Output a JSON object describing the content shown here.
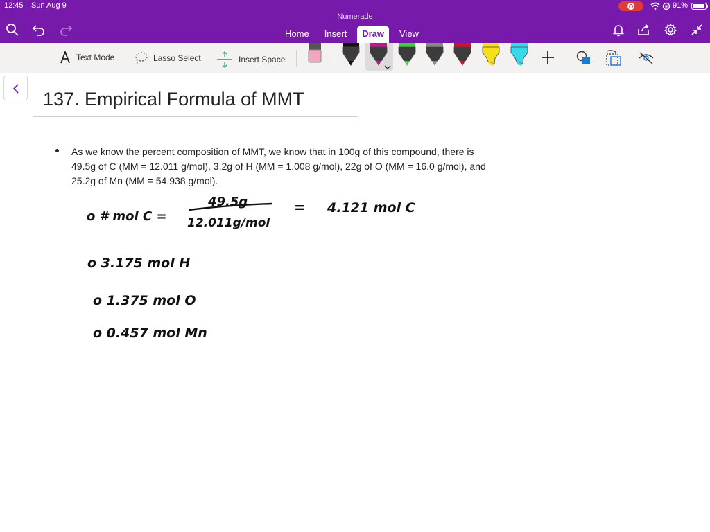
{
  "status_bar": {
    "time": "12:45",
    "date": "Sun Aug 9",
    "battery": "91%"
  },
  "app": {
    "title": "Numerade"
  },
  "tabs": [
    {
      "label": "Home"
    },
    {
      "label": "Insert"
    },
    {
      "label": "Draw",
      "active": true
    },
    {
      "label": "View"
    }
  ],
  "toolbar": {
    "text_mode": "Text Mode",
    "lasso_select": "Lasso Select",
    "insert_space": "Insert Space",
    "pens": [
      {
        "name": "eraser",
        "color": "#f4a6c0"
      },
      {
        "name": "pen-black",
        "color": "#111111"
      },
      {
        "name": "pen-magenta",
        "color": "#c4148f",
        "selected": true
      },
      {
        "name": "pen-green",
        "color": "#3ccf3c"
      },
      {
        "name": "pen-gray",
        "color": "#888888"
      },
      {
        "name": "pen-red",
        "color": "#d0112b"
      },
      {
        "name": "highlighter-yellow",
        "color": "#f5e11a"
      },
      {
        "name": "highlighter-cyan",
        "color": "#39d8ea"
      }
    ]
  },
  "page": {
    "title": "137. Empirical Formula of MMT",
    "bullet_lines": [
      "As we know the percent composition of MMT, we know that in 100g of this compound, there is",
      "49.5g of C (MM = 12.011 g/mol), 3.2g of H (MM = 1.008 g/mol), 22g of O (MM = 16.0 g/mol), and",
      "25.2g of Mn (MM = 54.938 g/mol)."
    ]
  },
  "handwriting": {
    "line1_label": "o # mol C  =",
    "numerator": "49.5g",
    "denominator": "12.011g/mol",
    "equals": "=",
    "result_c": "4.121  mol  C",
    "line2": "o  3.175  mol  H",
    "line3": "o  1.375  mol  O",
    "line4": "o  0.457  mol  Mn"
  },
  "colors": {
    "brand_purple": "#7719aa",
    "toolbar_bg": "#f3f2f1"
  }
}
